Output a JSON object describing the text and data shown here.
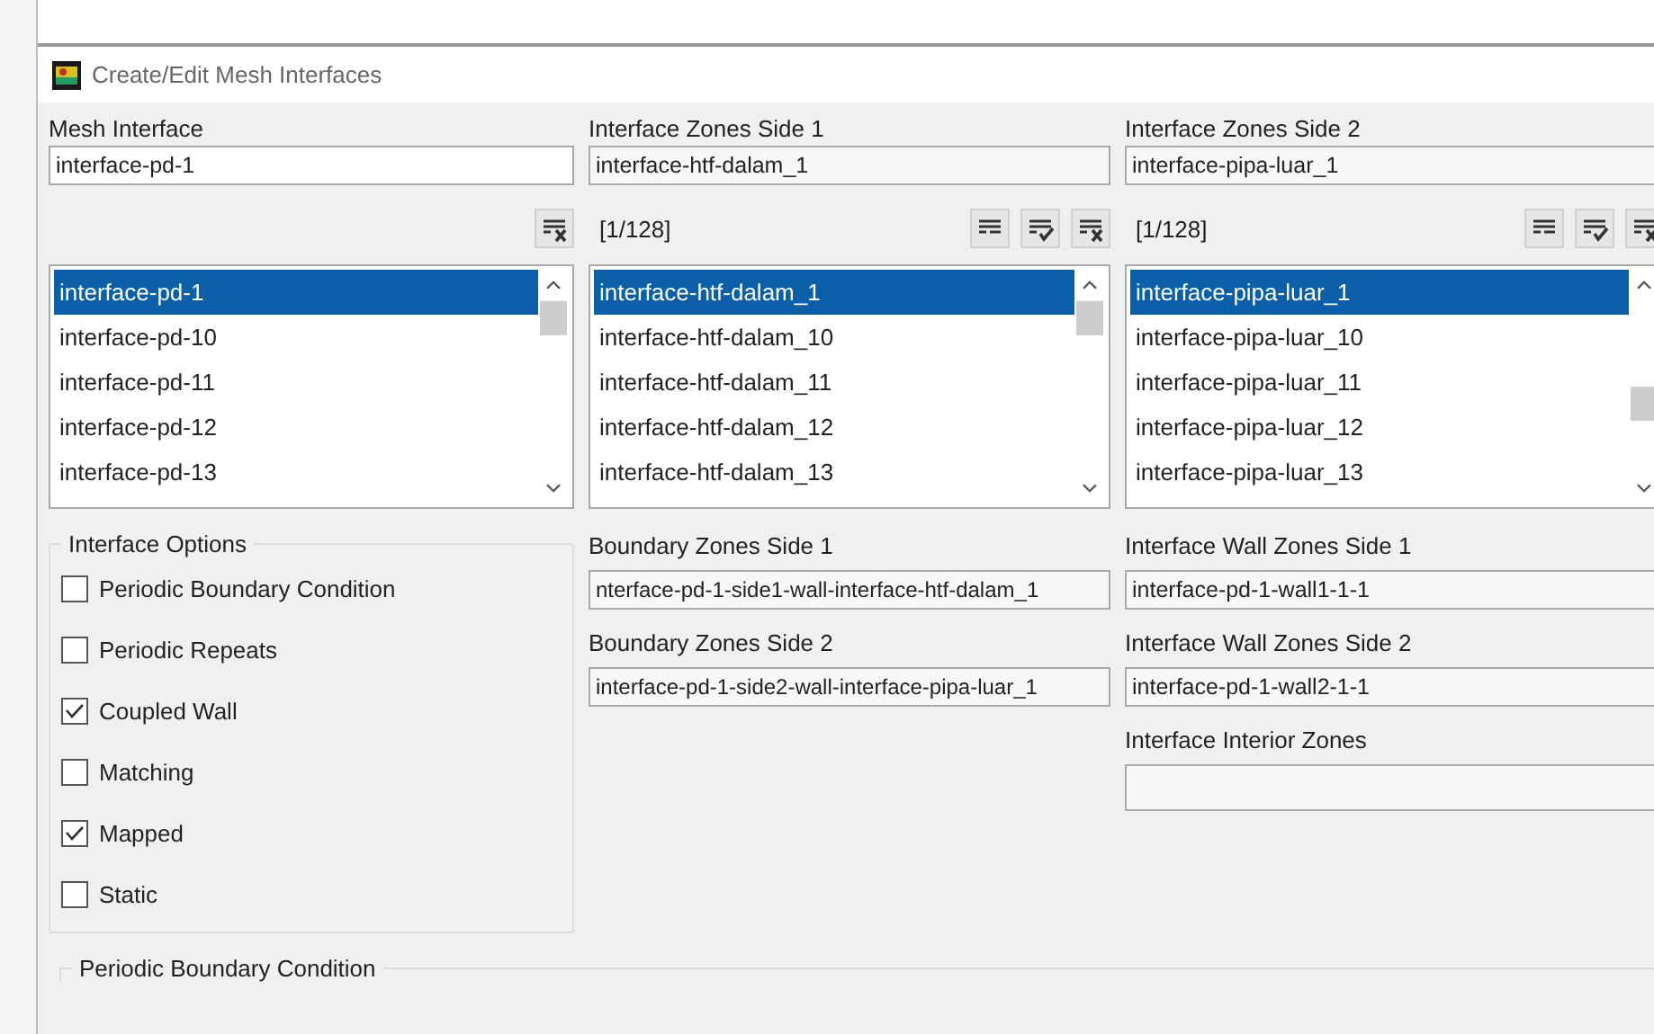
{
  "window": {
    "title": "Create/Edit Mesh Interfaces"
  },
  "columns": [
    {
      "label": "Mesh Interface",
      "value": "interface-pd-1",
      "tools": [
        {
          "kind": "clear"
        }
      ],
      "items": [
        {
          "text": "interface-pd-1",
          "selected": true
        },
        {
          "text": "interface-pd-10",
          "selected": false
        },
        {
          "text": "interface-pd-11",
          "selected": false
        },
        {
          "text": "interface-pd-12",
          "selected": false
        },
        {
          "text": "interface-pd-13",
          "selected": false
        }
      ]
    },
    {
      "label": "Interface Zones Side 1",
      "value": "interface-htf-dalam_1",
      "count": "[1/128]",
      "tools": [
        {
          "kind": "select"
        },
        {
          "kind": "check"
        },
        {
          "kind": "clear"
        }
      ],
      "items": [
        {
          "text": "interface-htf-dalam_1",
          "selected": true
        },
        {
          "text": "interface-htf-dalam_10",
          "selected": false
        },
        {
          "text": "interface-htf-dalam_11",
          "selected": false
        },
        {
          "text": "interface-htf-dalam_12",
          "selected": false
        },
        {
          "text": "interface-htf-dalam_13",
          "selected": false
        }
      ]
    },
    {
      "label": "Interface Zones Side 2",
      "value": "interface-pipa-luar_1",
      "count": "[1/128]",
      "tools": [
        {
          "kind": "select"
        },
        {
          "kind": "check"
        },
        {
          "kind": "clear"
        }
      ],
      "items": [
        {
          "text": "interface-pipa-luar_1",
          "selected": true
        },
        {
          "text": "interface-pipa-luar_10",
          "selected": false
        },
        {
          "text": "interface-pipa-luar_11",
          "selected": false
        },
        {
          "text": "interface-pipa-luar_12",
          "selected": false
        },
        {
          "text": "interface-pipa-luar_13",
          "selected": false
        }
      ]
    }
  ],
  "interface_options": {
    "title": "Interface Options",
    "options": [
      {
        "label": "Periodic Boundary Condition",
        "checked": false
      },
      {
        "label": "Periodic Repeats",
        "checked": false
      },
      {
        "label": "Coupled Wall",
        "checked": true
      },
      {
        "label": "Matching",
        "checked": false
      },
      {
        "label": "Mapped",
        "checked": true
      },
      {
        "label": "Static",
        "checked": false
      }
    ]
  },
  "boundary_zones": [
    {
      "label": "Boundary Zones Side 1",
      "value": "nterface-pd-1-side1-wall-interface-htf-dalam_1"
    },
    {
      "label": "Boundary Zones Side 2",
      "value": "interface-pd-1-side2-wall-interface-pipa-luar_1"
    }
  ],
  "wall_zones": [
    {
      "label": "Interface Wall Zones Side 1",
      "value": "interface-pd-1-wall1-1-1"
    },
    {
      "label": "Interface Wall Zones Side 2",
      "value": "interface-pd-1-wall2-1-1"
    },
    {
      "label": "Interface Interior Zones"
    }
  ],
  "periodic_group": {
    "title": "Periodic Boundary Condition"
  }
}
